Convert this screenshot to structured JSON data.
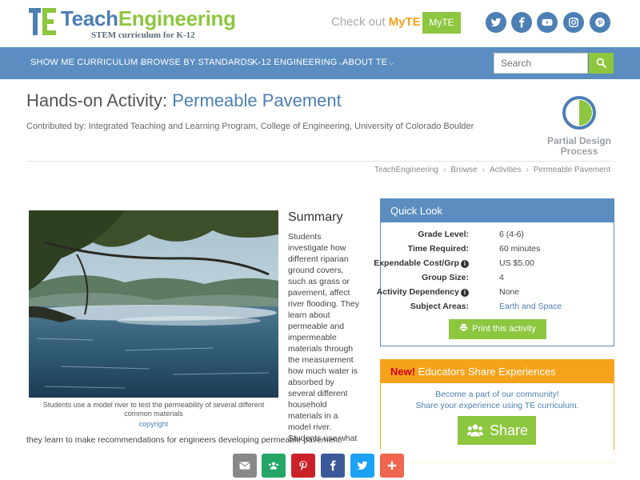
{
  "header": {
    "logo_teach": "Teach",
    "logo_engineering": "Engineering",
    "logo_sub": "STEM curriculum for K-12",
    "checkout_text": "Check out",
    "checkout_brand": "MyTE",
    "myte_button": "MyTE",
    "social": [
      "twitter-icon",
      "facebook-icon",
      "youtube-icon",
      "instagram-icon",
      "pinterest-icon"
    ]
  },
  "nav": {
    "items": [
      "SHOW ME CURRICULUM",
      "BROWSE BY STANDARDS",
      "K-12 ENGINEERING",
      "ABOUT TE"
    ],
    "search_placeholder": "Search"
  },
  "page": {
    "title_prefix": "Hands-on Activity:",
    "title_name": "Permeable Pavement",
    "contributed_by": "Contributed by: Integrated Teaching and Learning Program, College of Engineering, University of Colorado Boulder",
    "design_process_label": "Partial Design Process",
    "breadcrumb": [
      "TeachEngineering",
      "Browse",
      "Activities",
      "Permeable Pavement"
    ]
  },
  "image": {
    "caption": "Students use a model river to test the permeability of several different common materials",
    "copyright": "copyright"
  },
  "summary": {
    "heading": "Summary",
    "text": "Students investigate how different riparian ground covers, such as grass or pavement, affect river flooding. They learn about permeable and impermeable materials through the measurement how much water is absorbed by several different household materials in a model river. Students use what",
    "continued": "they learn to make recommendations for engineers developing permeable pavement."
  },
  "quick_look": {
    "heading": "Quick Look",
    "rows": [
      {
        "label": "Grade Level:",
        "value": "6 (4-6)"
      },
      {
        "label": "Time Required:",
        "value": "60 minutes"
      },
      {
        "label": "Expendable Cost/Grp",
        "value": "US $5.00"
      },
      {
        "label": "Group Size:",
        "value": "4"
      },
      {
        "label": "Activity Dependency",
        "value": "None"
      },
      {
        "label": "Subject Areas:",
        "value": "Earth and Space"
      }
    ],
    "print_button": "Print this activity"
  },
  "share": {
    "new_label": "New!",
    "heading": "Educators Share Experiences",
    "line1": "Become a part of our community!",
    "line2": "Share your experience using TE curriculum.",
    "button": "Share"
  },
  "float_bar": {
    "buttons": [
      {
        "icon": "email-icon",
        "color": "#888888"
      },
      {
        "icon": "google-classroom-icon",
        "color": "#25a667"
      },
      {
        "icon": "pinterest-icon",
        "color": "#cb2027"
      },
      {
        "icon": "facebook-icon",
        "color": "#3b5998"
      },
      {
        "icon": "twitter-icon",
        "color": "#1da1f2"
      },
      {
        "icon": "more-plus-icon",
        "color": "#f0654f"
      }
    ]
  },
  "colors": {
    "brand_blue": "#4c7fb4",
    "nav_blue": "#5b8dc0",
    "brand_green": "#8dc63f",
    "brand_orange": "#f7a21b"
  }
}
